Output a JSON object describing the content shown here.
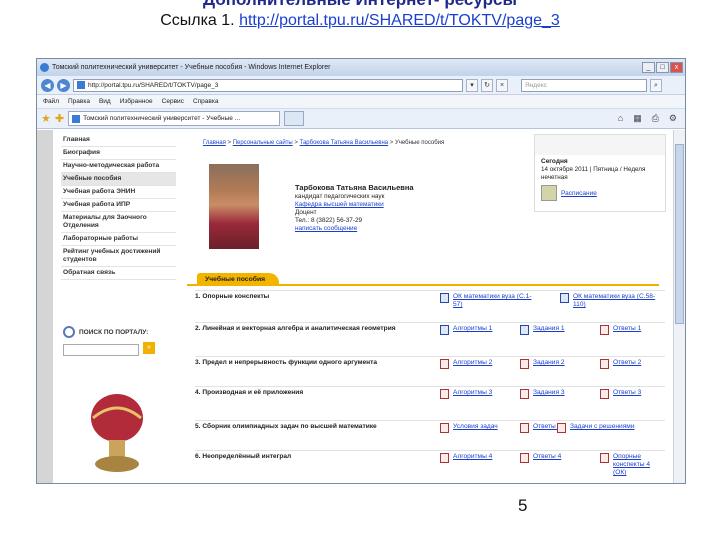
{
  "slide": {
    "title": "Дополнительные Интернет- ресурсы",
    "subtitle_prefix": "Ссылка 1. ",
    "subtitle_link": "http://portal.tpu.ru/SHARED/t/TOKTV/page_3",
    "page_number": "5"
  },
  "browser": {
    "window_title": "Томский политехнический университет - Учебные пособия - Windows Internet Explorer",
    "url": "http://portal.tpu.ru/SHARED/t/TOKTV/page_3",
    "search_placeholder": "Яндекс",
    "menu": [
      "Файл",
      "Правка",
      "Вид",
      "Избранное",
      "Сервис",
      "Справка"
    ],
    "tab_label": "Томский политехнический университет - Учебные ..."
  },
  "sidebar": {
    "items": [
      "Главная",
      "Биография",
      "Научно-методическая работа",
      "Учебные пособия",
      "Учебная работа ЭНИН",
      "Учебная работа ИПР",
      "Материалы для Заочного Отделения",
      "Лабораторные работы",
      "Рейтинг учебных достижений студентов",
      "Обратная связь"
    ],
    "search_label": "ПОИСК ПО ПОРТАЛУ:",
    "go": "»"
  },
  "breadcrumb": {
    "items": [
      "Главная",
      "Персональные сайты",
      "Тарбокова Татьяна Васильевна"
    ],
    "current": "Учебные пособия",
    "separator": " > "
  },
  "today": {
    "label": "Сегодня",
    "date": "14 октября 2011 | Пятница / Неделя нечетная",
    "schedule": "Расписание"
  },
  "person": {
    "name": "Тарбокова Татьяна Васильевна",
    "degree": "кандидат педагогических наук",
    "department": "Кафедра высшей математики",
    "position": "Доцент",
    "phone": "Тел.: 8 (3822)  56-37-29",
    "write": "написать сообщение"
  },
  "section": {
    "tab": "Учебные пособия",
    "rows": [
      {
        "title": "1. Опорные конспекты",
        "cells": [
          "ОК математики вуза (С.1-57)",
          "ОК математики вуза (С.58-110)"
        ]
      },
      {
        "title": "2. Линейная и векторная алгебра и аналитическая геометрия",
        "cells": [
          "Алгоритмы 1",
          "Задания 1",
          "Ответы 1"
        ]
      },
      {
        "title": "3. Предел и непрерывность функции одного аргумента",
        "cells": [
          "Алгоритмы 2",
          "Задания 2",
          "Ответы 2"
        ]
      },
      {
        "title": "4. Производная и её приложения",
        "cells": [
          "Алгоритмы 3",
          "Задания 3",
          "Ответы 3"
        ]
      },
      {
        "title": "5. Сборник олимпиадных задач по высшей математике",
        "cells": [
          "Условия задач",
          "Ответы 5",
          "Задачи с решениями"
        ]
      },
      {
        "title": "6. Неопределённый интеграл",
        "cells": [
          "Алгоритмы 4",
          "Ответы 4",
          "Опорные конспекты 4 (ОК)"
        ]
      }
    ]
  }
}
